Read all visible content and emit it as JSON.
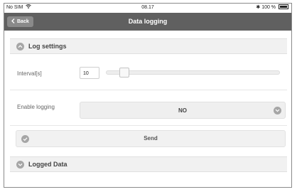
{
  "status_bar": {
    "carrier": "No SIM",
    "time": "08.17",
    "battery": "100 %",
    "bluetooth": "✱"
  },
  "nav": {
    "back_label": "Back",
    "title": "Data logging"
  },
  "log_settings": {
    "header": "Log settings",
    "interval_label": "Interval[s]",
    "interval_value": "10",
    "slider_fraction": 0.08,
    "enable_label": "Enable logging",
    "enable_value": "NO",
    "send_label": "Send"
  },
  "logged_data": {
    "header": "Logged Data"
  },
  "colors": {
    "navbar": "#606060",
    "header_bg": "#f1f1f1",
    "icon": "#a6a6a6"
  }
}
